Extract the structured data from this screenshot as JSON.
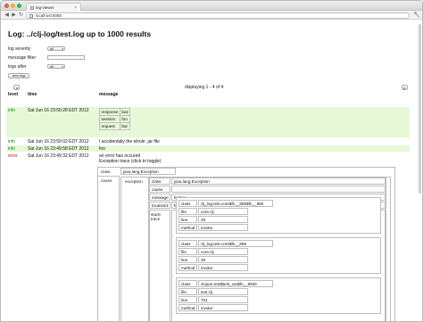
{
  "browser": {
    "tab_title": "log-viewer",
    "tab_close": "×",
    "url": "localhost:8080",
    "back_glyph": "◀",
    "forward_glyph": "▶",
    "reload_glyph": "↻",
    "menu_glyph": "🔧"
  },
  "page": {
    "title": "Log: ../clj-log/test.log up to 1000 results"
  },
  "filters": {
    "severity_label": "log severity",
    "severity_value": "all",
    "message_label": "message filter",
    "message_value": "",
    "after_label": "logs after",
    "after_value": "all",
    "view_button": "view logs"
  },
  "pager": {
    "display_text": "displaying 1 - 4 of 4",
    "prev_glyph": "◂",
    "next_glyph": "▸"
  },
  "columns": {
    "level": "level",
    "time": "time",
    "message": "message"
  },
  "rows": [
    {
      "level": "info",
      "time": "Sat Jun 16 23:50:28 EDT 2012",
      "kv": [
        {
          "key": "response",
          "value": "baz"
        },
        {
          "key": "session",
          "value": "foo"
        },
        {
          "key": "request",
          "value": "bar"
        }
      ]
    },
    {
      "level": "info",
      "time": "Sat Jun 16 23:50:02 EDT 2012",
      "message": "I accidentally the whole .jar file"
    },
    {
      "level": "info",
      "time": "Sat Jun 16 23:49:58 EDT 2012",
      "message": "foo"
    },
    {
      "level": "error",
      "time": "Sat Jun 16 23:49:32 EDT 2012",
      "message": "an error has occured",
      "trace_toggle": "Exception trace (click to toggle)",
      "class_label": "class",
      "class_value": "java.lang.Exception",
      "cause_label": "cause",
      "exception_label": "exception",
      "exception": {
        "class_label": "class",
        "class_value": "java.lang.Exception",
        "cause_label": "cause",
        "message_label": "message",
        "message_value": "foobar",
        "localized_label": "localized",
        "localized_value": "foobar",
        "stack_label": "stack-\ntrace",
        "frames": [
          {
            "class": "clj_log.test.core$fn__859$fn__860",
            "file": "core.clj",
            "line": "29",
            "method": "invoke"
          },
          {
            "class": "clj_log.test.core$fn__859",
            "file": "core.clj",
            "line": "29",
            "method": "invoke"
          },
          {
            "class": "clojure.test$test_var$fn__6926",
            "file": "test.clj",
            "line": "701",
            "method": "invoke"
          }
        ]
      }
    }
  ],
  "frame_labels": {
    "class": "class",
    "file": "file",
    "line": "line",
    "method": "method"
  },
  "colors": {
    "info": "#118811",
    "error": "#cc1111",
    "highlight_row": "#e6f8d8"
  }
}
